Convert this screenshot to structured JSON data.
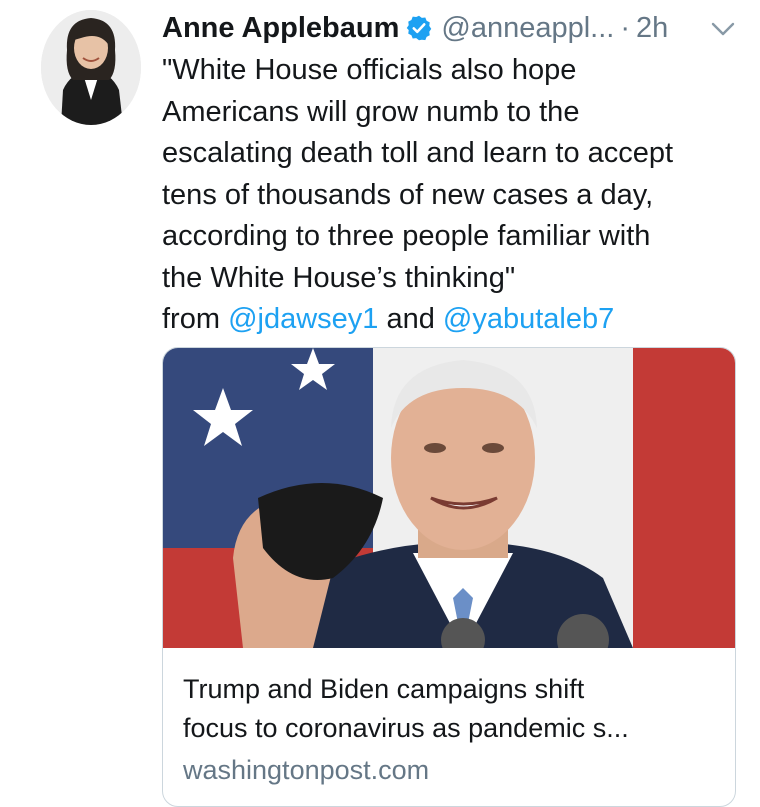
{
  "tweet": {
    "author_name": "Anne Applebaum",
    "handle": "@anneappl...",
    "separator": "·",
    "time": "2h",
    "text_lines": [
      "\"White House officials also hope",
      "Americans will grow numb to the",
      "escalating death toll and learn to accept",
      "tens of thousands of new cases a day,",
      "according to three people familiar with",
      "the White House’s thinking\""
    ],
    "attribution": {
      "prefix": "from ",
      "mention1": "@jdawsey1",
      "joiner": " and ",
      "mention2": "@yabutaleb7"
    }
  },
  "card": {
    "title_lines": [
      "Trump and Biden campaigns shift",
      "focus to coronavirus as pandemic s..."
    ],
    "domain": "washingtonpost.com"
  },
  "icons": {
    "verified": "verified-badge-icon",
    "chevron": "chevron-down-icon"
  },
  "colors": {
    "link": "#1da1f2",
    "secondary_text": "#657786",
    "primary_text": "#14171a",
    "verified": "#1da1f2"
  }
}
